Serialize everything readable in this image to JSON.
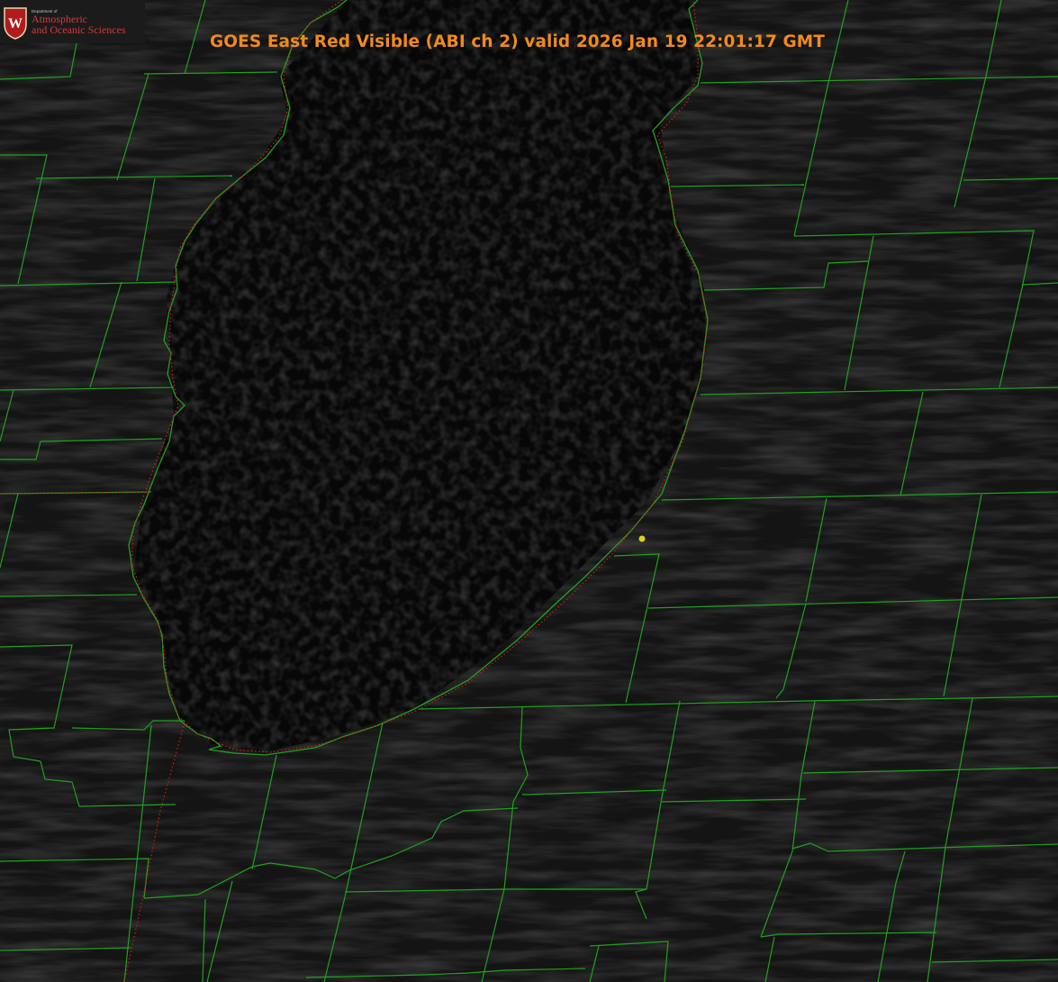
{
  "title": "GOES East Red Visible (ABI ch 2) valid 2026 Jan 19 22:01:17 GMT",
  "logo": {
    "shield_letter": "W",
    "department_line": "Department of",
    "name_line1": "Atmospheric",
    "name_line2": "and Oceanic Sciences"
  },
  "colors": {
    "title": "#ef8a1e",
    "county_lines": "#1fa11f",
    "state_border": "#d01818",
    "station_marker": "#d6d21e",
    "lake": "#070707",
    "land": "#141414"
  }
}
